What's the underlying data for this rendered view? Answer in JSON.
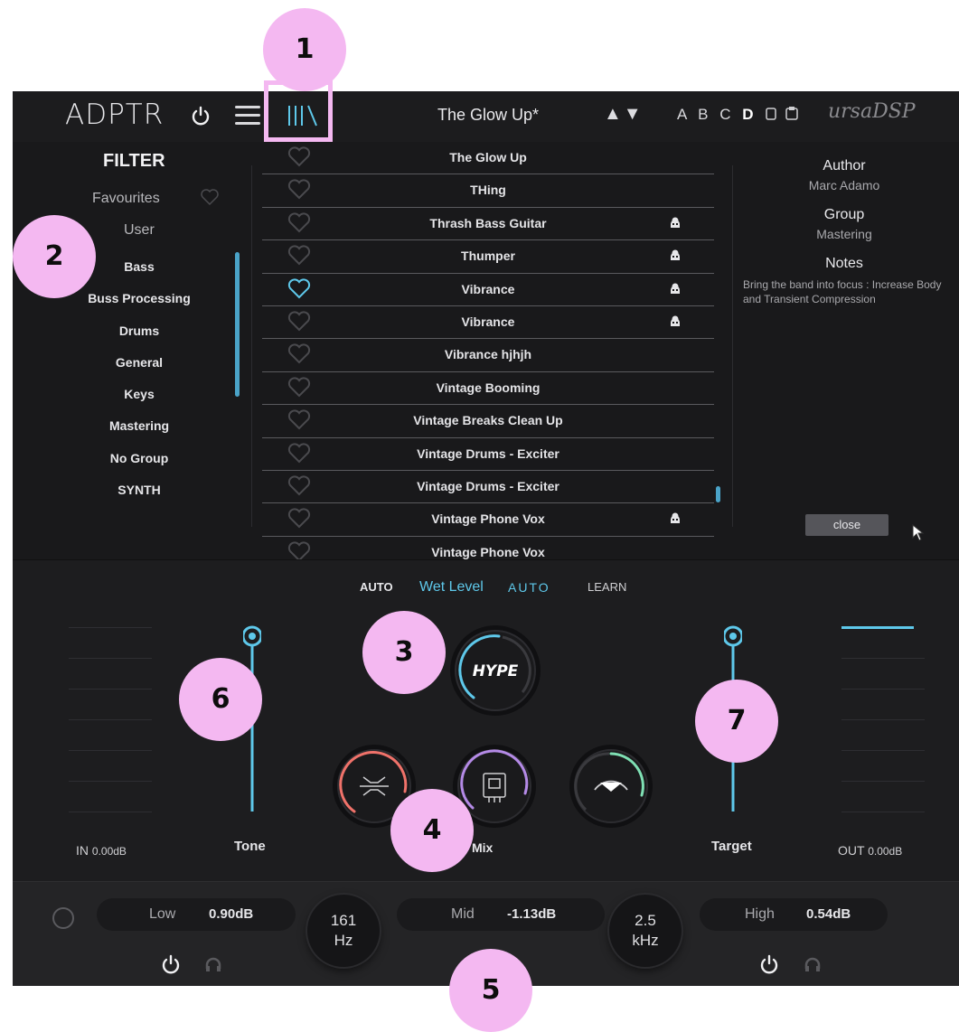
{
  "header": {
    "logo": "ADPTR",
    "preset_title": "The Glow Up*",
    "nav_arrows": "▲▼",
    "ab_slots": [
      "A",
      "B",
      "C"
    ],
    "ab_active": "D",
    "brand": "ursaDSP"
  },
  "filter": {
    "title": "FILTER",
    "favourites": "Favourites",
    "user": "User",
    "groups": [
      "Bass",
      "Buss Processing",
      "Drums",
      "General",
      "Keys",
      "Mastering",
      "No Group",
      "SYNTH"
    ]
  },
  "presets": [
    {
      "name": "The Glow Up",
      "fav": false,
      "user": false
    },
    {
      "name": "THing",
      "fav": false,
      "user": false
    },
    {
      "name": "Thrash Bass Guitar",
      "fav": false,
      "user": true
    },
    {
      "name": "Thumper",
      "fav": false,
      "user": true
    },
    {
      "name": "Vibrance",
      "fav": true,
      "user": true
    },
    {
      "name": "Vibrance",
      "fav": false,
      "user": true
    },
    {
      "name": "Vibrance hjhjh",
      "fav": false,
      "user": false
    },
    {
      "name": "Vintage Booming",
      "fav": false,
      "user": false
    },
    {
      "name": "Vintage Breaks Clean Up",
      "fav": false,
      "user": false
    },
    {
      "name": "Vintage Drums - Exciter",
      "fav": false,
      "user": false
    },
    {
      "name": "Vintage Drums - Exciter",
      "fav": false,
      "user": false
    },
    {
      "name": "Vintage Phone Vox",
      "fav": false,
      "user": true
    },
    {
      "name": "Vintage Phone Vox",
      "fav": false,
      "user": false
    }
  ],
  "info": {
    "author_label": "Author",
    "author": "Marc Adamo",
    "group_label": "Group",
    "group": "Mastering",
    "notes_label": "Notes",
    "notes": "Bring the band into focus : Increase Body and Transient Compression",
    "close": "close"
  },
  "main": {
    "auto_left": "AUTO",
    "wet_level": "Wet Level",
    "auto_right": "AUTO",
    "learn": "LEARN",
    "hype": "HYPE",
    "in_label": "IN",
    "in_value": "0.00dB",
    "out_label": "OUT",
    "out_value": "0.00dB",
    "tone": "Tone",
    "target": "Target",
    "mix": "Mix"
  },
  "eq": {
    "low_label": "Low",
    "low_value": "0.90dB",
    "low_freq_value": "161",
    "low_freq_unit": "Hz",
    "mid_label": "Mid",
    "mid_value": "-1.13dB",
    "mid_freq_value": "2.5",
    "mid_freq_unit": "kHz",
    "high_label": "High",
    "high_value": "0.54dB"
  },
  "badges": [
    "1",
    "2",
    "3",
    "4",
    "5",
    "6",
    "7"
  ],
  "colors": {
    "accent": "#5ec8ea",
    "badge": "#f4b8f1",
    "red": "#f0726a",
    "purple": "#b48ae6",
    "green": "#7fe0b4"
  }
}
